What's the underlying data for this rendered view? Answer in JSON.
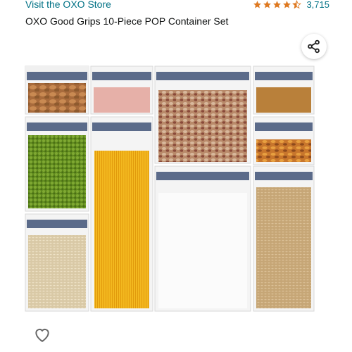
{
  "header": {
    "store_link": "Visit the OXO Store",
    "rating": 4.5,
    "review_count": "3,715"
  },
  "product": {
    "title": "OXO Good Grips 10-Piece POP Container Set"
  },
  "icons": {
    "share": "share-icon",
    "favorite": "heart-outline-icon",
    "rating": "star-icon"
  },
  "colors": {
    "link": "#007185",
    "star": "#DE7921",
    "text": "#0F1111"
  }
}
